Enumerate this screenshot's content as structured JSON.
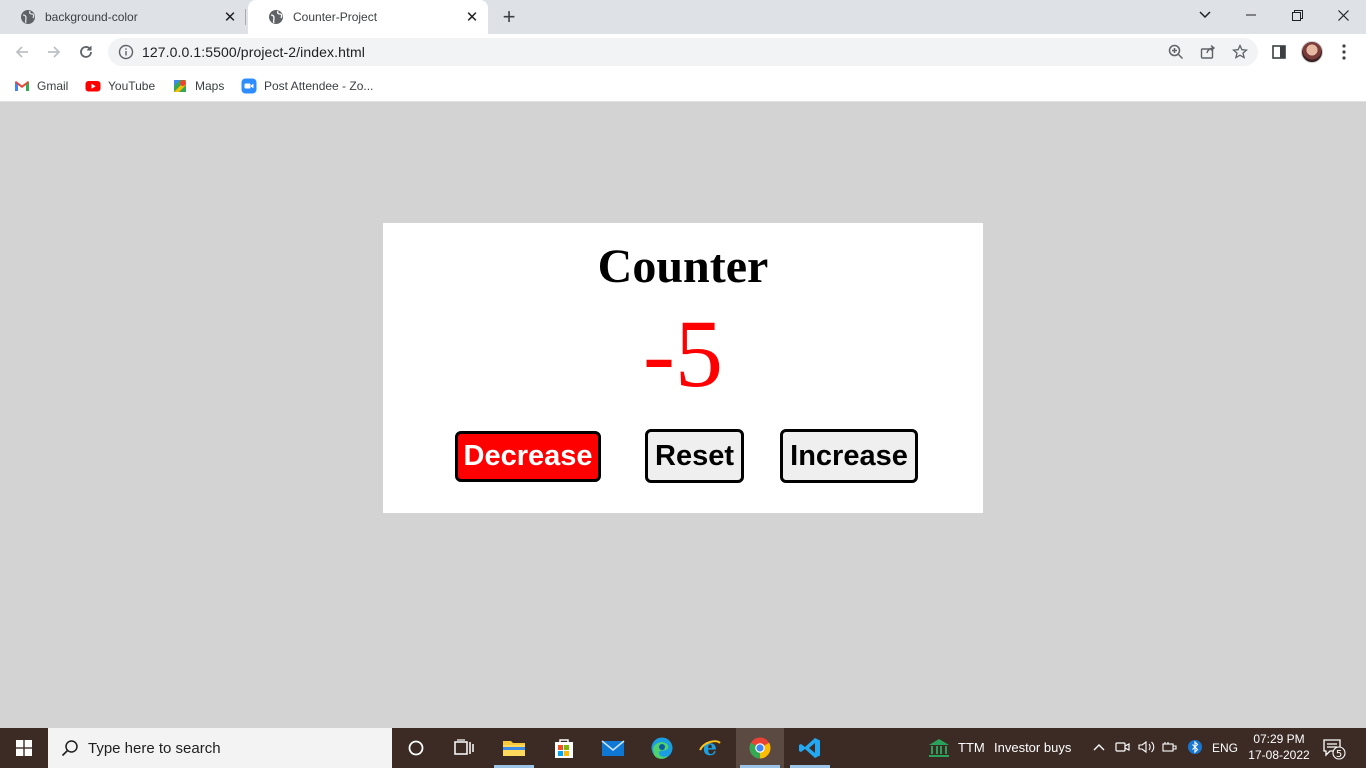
{
  "browser": {
    "tabs": [
      {
        "title": "background-color",
        "active": false
      },
      {
        "title": "Counter-Project",
        "active": true
      }
    ],
    "address": "127.0.0.1:5500/project-2/index.html",
    "bookmarks": [
      {
        "label": "Gmail",
        "icon": "gmail-icon"
      },
      {
        "label": "YouTube",
        "icon": "youtube-icon"
      },
      {
        "label": "Maps",
        "icon": "maps-icon"
      },
      {
        "label": "Post Attendee - Zo...",
        "icon": "zoom-icon"
      }
    ]
  },
  "page": {
    "title": "Counter",
    "count": "-5",
    "count_color": "#ff0000",
    "buttons": {
      "decrease": "Decrease",
      "reset": "Reset",
      "increase": "Increase"
    },
    "decrease_bg": "#ff0000"
  },
  "taskbar": {
    "search_placeholder": "Type here to search",
    "stock_ticker": "TTM",
    "stock_text": "Investor buys",
    "language": "ENG",
    "time": "07:29 PM",
    "date": "17-08-2022",
    "notification_count": "5"
  }
}
